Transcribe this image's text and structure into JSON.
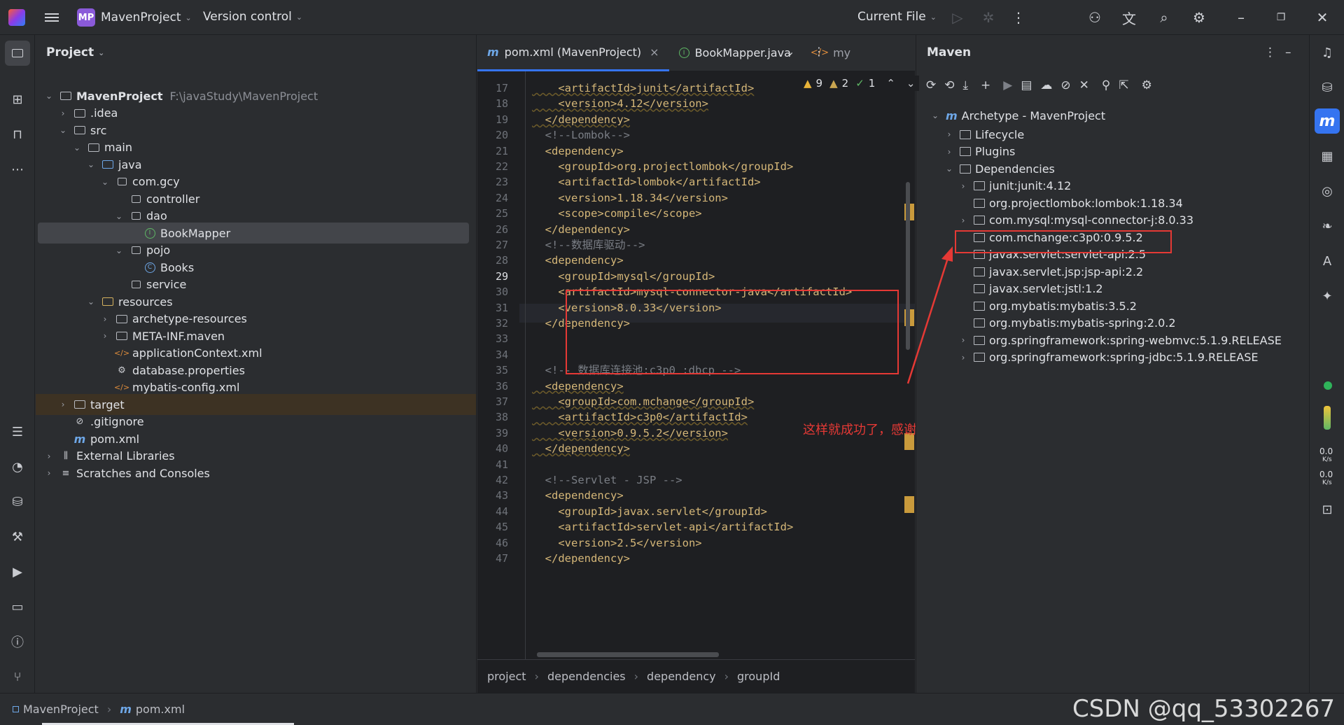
{
  "titlebar": {
    "project_badge": "MP",
    "project_name": "MavenProject",
    "version_control": "Version control",
    "run_config": "Current File"
  },
  "project_panel": {
    "title": "Project",
    "tree": [
      {
        "label": "MavenProject",
        "sub": "F:\\javaStudy\\MavenProject",
        "depth": 0,
        "arrow": "⌄",
        "icon": "folder-icon"
      },
      {
        "label": ".idea",
        "depth": 1,
        "arrow": "›",
        "icon": "folder-icon"
      },
      {
        "label": "src",
        "depth": 1,
        "arrow": "⌄",
        "icon": "folder-icon"
      },
      {
        "label": "main",
        "depth": 2,
        "arrow": "⌄",
        "icon": "folder-icon"
      },
      {
        "label": "java",
        "depth": 3,
        "arrow": "⌄",
        "icon": "source-folder-icon"
      },
      {
        "label": "com.gcy",
        "depth": 4,
        "arrow": "⌄",
        "icon": "package-icon"
      },
      {
        "label": "controller",
        "depth": 5,
        "arrow": "",
        "icon": "package-icon"
      },
      {
        "label": "dao",
        "depth": 5,
        "arrow": "⌄",
        "icon": "package-icon"
      },
      {
        "label": "BookMapper",
        "depth": 6,
        "arrow": "",
        "icon": "interface-icon"
      },
      {
        "label": "pojo",
        "depth": 5,
        "arrow": "⌄",
        "icon": "package-icon"
      },
      {
        "label": "Books",
        "depth": 6,
        "arrow": "",
        "icon": "class-icon"
      },
      {
        "label": "service",
        "depth": 5,
        "arrow": "",
        "icon": "package-icon"
      },
      {
        "label": "resources",
        "depth": 3,
        "arrow": "⌄",
        "icon": "resources-folder-icon"
      },
      {
        "label": "archetype-resources",
        "depth": 4,
        "arrow": "›",
        "icon": "folder-icon"
      },
      {
        "label": "META-INF.maven",
        "depth": 4,
        "arrow": "›",
        "icon": "folder-icon"
      },
      {
        "label": "applicationContext.xml",
        "depth": 4,
        "arrow": "",
        "icon": "xml-icon"
      },
      {
        "label": "database.properties",
        "depth": 4,
        "arrow": "",
        "icon": "properties-icon"
      },
      {
        "label": "mybatis-config.xml",
        "depth": 4,
        "arrow": "",
        "icon": "xml-icon"
      },
      {
        "label": "target",
        "depth": 1,
        "arrow": "›",
        "icon": "folder-icon"
      },
      {
        "label": ".gitignore",
        "depth": 1,
        "arrow": "",
        "icon": "ignore-icon"
      },
      {
        "label": "pom.xml",
        "depth": 1,
        "arrow": "",
        "icon": "maven-icon"
      },
      {
        "label": "External Libraries",
        "depth": 0,
        "arrow": "›",
        "icon": "library-icon"
      },
      {
        "label": "Scratches and Consoles",
        "depth": 0,
        "arrow": "›",
        "icon": "scratches-icon"
      }
    ]
  },
  "editor": {
    "tabs": [
      {
        "label": "pom.xml (MavenProject)",
        "close": "×"
      },
      {
        "label": "BookMapper.java"
      },
      {
        "label": "my"
      }
    ],
    "inspections": {
      "warnings": "9",
      "weak_warnings": "2",
      "ok": "1"
    },
    "line_numbers": [
      "17",
      "18",
      "19",
      "20",
      "21",
      "22",
      "23",
      "24",
      "25",
      "26",
      "27",
      "28",
      "29",
      "30",
      "31",
      "32",
      "33",
      "34",
      "35",
      "36",
      "37",
      "38",
      "39",
      "40",
      "41",
      "42",
      "43",
      "44",
      "45",
      "46",
      "47"
    ],
    "lines": [
      "    <artifactId>junit</artifactId>",
      "    <version>4.12</version>",
      "  </dependency>",
      "  <!--Lombok-->",
      "  <dependency>",
      "    <groupId>org.projectlombok</groupId>",
      "    <artifactId>lombok</artifactId>",
      "    <version>1.18.34</version>",
      "    <scope>compile</scope>",
      "  </dependency>",
      "  <!--数据库驱动-->",
      "  <dependency>",
      "    <groupId>mysql</groupId>",
      "    <artifactId>mysql-connector-java</artifactId>",
      "    <version>8.0.33</version>",
      "  </dependency>",
      "",
      "",
      "  <!-- 数据库连接池:c3p0 :dbcp -->",
      "  <dependency>",
      "    <groupId>com.mchange</groupId>",
      "    <artifactId>c3p0</artifactId>",
      "    <version>0.9.5.2</version>",
      "  </dependency>",
      "",
      "  <!--Servlet - JSP -->",
      "  <dependency>",
      "    <groupId>javax.servlet</groupId>",
      "    <artifactId>servlet-api</artifactId>",
      "    <version>2.5</version>",
      "  </dependency>"
    ],
    "breadcrumb": [
      "project",
      "dependencies",
      "dependency",
      "groupId"
    ],
    "annotation": "这样就成功了，感谢强大的IDEA"
  },
  "maven_panel": {
    "title": "Maven",
    "root": "Archetype - MavenProject",
    "items": [
      {
        "label": "Lifecycle",
        "depth": 1,
        "arrow": "›"
      },
      {
        "label": "Plugins",
        "depth": 1,
        "arrow": "›"
      },
      {
        "label": "Dependencies",
        "depth": 1,
        "arrow": "⌄"
      },
      {
        "label": "junit:junit:4.12",
        "depth": 2,
        "arrow": "›"
      },
      {
        "label": "org.projectlombok:lombok:1.18.34",
        "depth": 2,
        "arrow": ""
      },
      {
        "label": "com.mysql:mysql-connector-j:8.0.33",
        "depth": 2,
        "arrow": "›"
      },
      {
        "label": "com.mchange:c3p0:0.9.5.2",
        "depth": 2,
        "arrow": ""
      },
      {
        "label": "javax.servlet:servlet-api:2.5",
        "depth": 2,
        "arrow": ""
      },
      {
        "label": "javax.servlet.jsp:jsp-api:2.2",
        "depth": 2,
        "arrow": ""
      },
      {
        "label": "javax.servlet:jstl:1.2",
        "depth": 2,
        "arrow": ""
      },
      {
        "label": "org.mybatis:mybatis:3.5.2",
        "depth": 2,
        "arrow": ""
      },
      {
        "label": "org.mybatis:mybatis-spring:2.0.2",
        "depth": 2,
        "arrow": ""
      },
      {
        "label": "org.springframework:spring-webmvc:5.1.9.RELEASE",
        "depth": 2,
        "arrow": "›"
      },
      {
        "label": "org.springframework:spring-jdbc:5.1.9.RELEASE",
        "depth": 2,
        "arrow": "›"
      }
    ]
  },
  "rightbar": {
    "net_up": "0.0",
    "net_up_unit": "K/s",
    "net_down": "0.0",
    "net_down_unit": "K/s"
  },
  "statusbar": {
    "project": "MavenProject",
    "file": "pom.xml",
    "watermark": "CSDN @qq_53302267"
  },
  "colors": {
    "accent": "#3574f0",
    "highlight_red": "#e53935",
    "xml_tag": "#d5b778"
  }
}
